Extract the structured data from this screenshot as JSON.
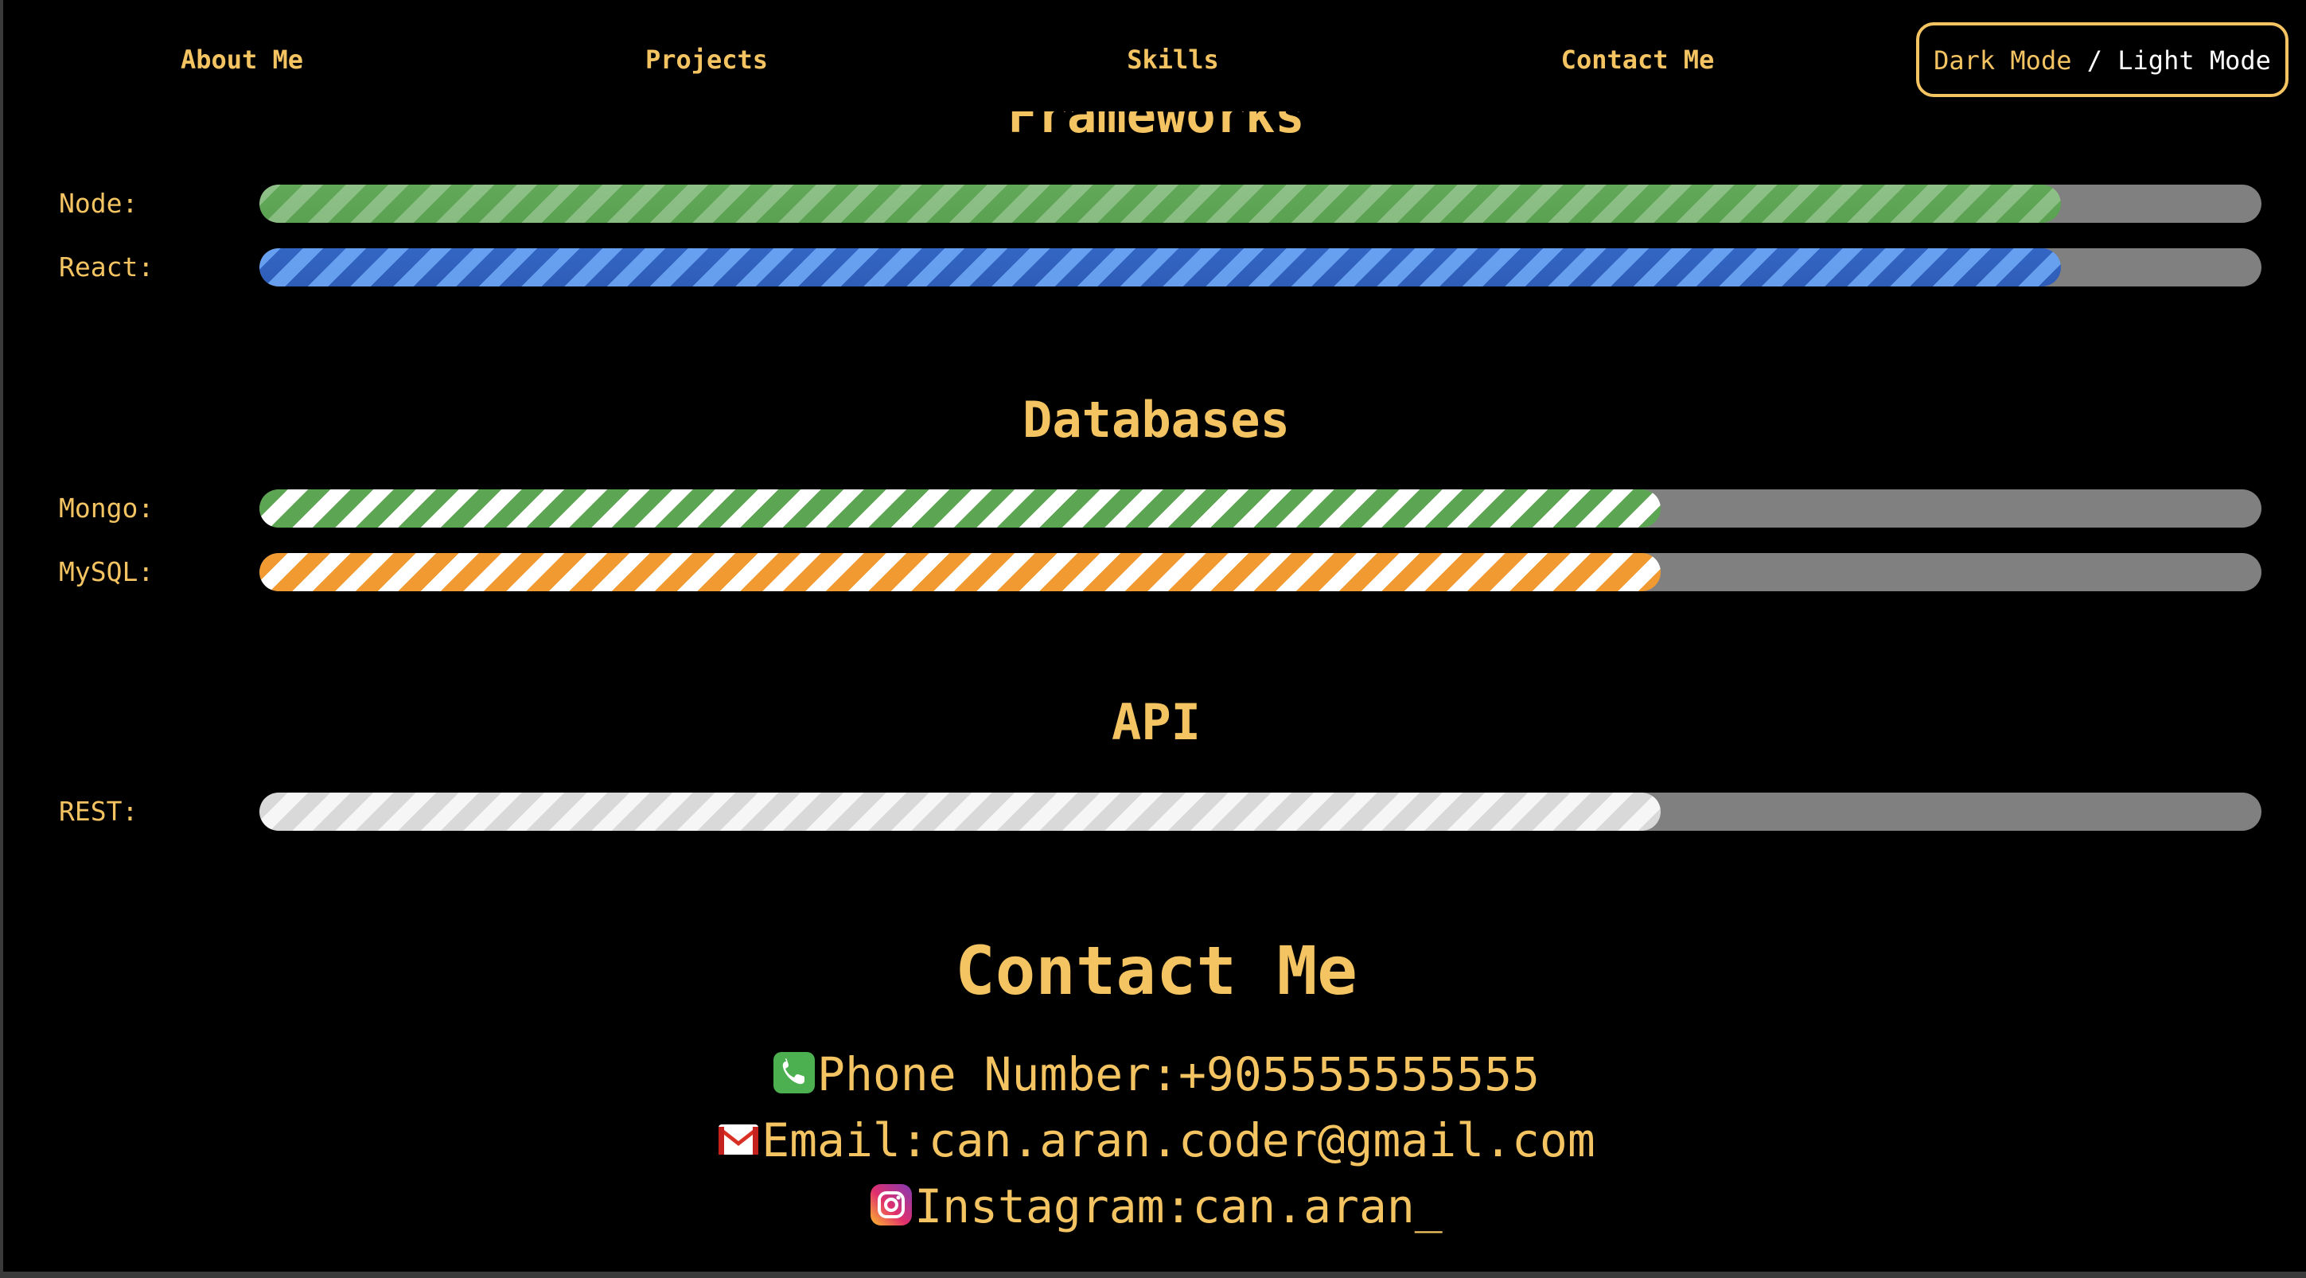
{
  "nav": {
    "items": [
      {
        "label": "About Me"
      },
      {
        "label": "Projects"
      },
      {
        "label": "Skills"
      },
      {
        "label": "Contact Me"
      }
    ],
    "mode_toggle": {
      "dark": "Dark Mode",
      "separator": "/",
      "light": "Light Mode"
    }
  },
  "skills": {
    "frameworks": {
      "title": "Frameworks",
      "items": [
        {
          "label": "Node:",
          "level_percent": 90,
          "color": "#5ca553"
        },
        {
          "label": "React:",
          "level_percent": 90,
          "color": "#3366c4"
        }
      ]
    },
    "databases": {
      "title": "Databases",
      "items": [
        {
          "label": "Mongo:",
          "level_percent": 70,
          "color": "#5ca553"
        },
        {
          "label": "MySQL:",
          "level_percent": 70,
          "color": "#f29a32"
        }
      ]
    },
    "api": {
      "title": "API",
      "items": [
        {
          "label": "REST:",
          "level_percent": 70,
          "color": "#d9d9d9"
        }
      ]
    }
  },
  "contact": {
    "title": "Contact Me",
    "phone": {
      "text": "Phone Number:+905555555555",
      "icon": "phone-icon"
    },
    "email": {
      "text": "Email:can.aran.coder@gmail.com",
      "icon": "gmail-icon"
    },
    "instagram": {
      "text": "Instagram:can.aran_",
      "icon": "instagram-icon"
    }
  },
  "colors": {
    "accent": "#f4c462",
    "background": "#000000",
    "track": "#808080"
  }
}
